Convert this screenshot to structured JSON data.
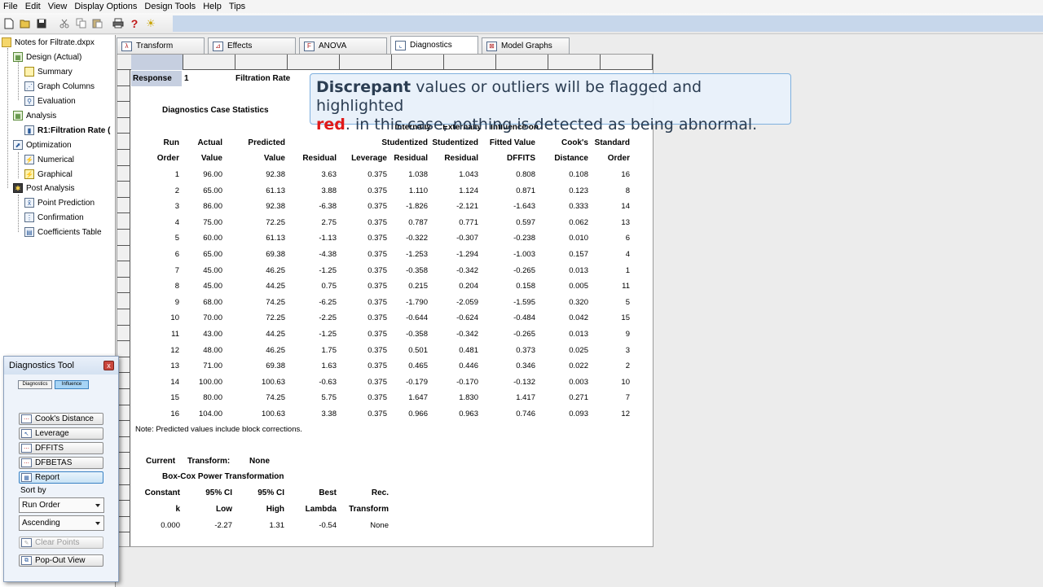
{
  "menu": [
    "File",
    "Edit",
    "View",
    "Display Options",
    "Design Tools",
    "Help",
    "Tips"
  ],
  "toolbar": {
    "icons": [
      "new-file-icon",
      "open-folder-icon",
      "save-icon",
      "cut-icon",
      "copy-icon",
      "paste-icon",
      "print-icon",
      "help-question-icon",
      "tip-lightbulb-icon"
    ],
    "help_glyph": "?",
    "tip_glyph": "☀"
  },
  "tree": {
    "root": "Notes for Filtrate.dxpx",
    "design": "Design (Actual)",
    "summary": "Summary",
    "graph_columns": "Graph Columns",
    "evaluation": "Evaluation",
    "analysis": "Analysis",
    "r1": "R1:Filtration Rate (",
    "optimization": "Optimization",
    "numerical": "Numerical",
    "graphical": "Graphical",
    "post_analysis": "Post Analysis",
    "point_prediction": "Point Prediction",
    "confirmation": "Confirmation",
    "coefficients_table": "Coefficients Table"
  },
  "tabs": [
    {
      "label": "Transform",
      "active": false
    },
    {
      "label": "Effects",
      "active": false
    },
    {
      "label": "ANOVA",
      "active": false
    },
    {
      "label": "Diagnostics",
      "active": true
    },
    {
      "label": "Model Graphs",
      "active": false
    }
  ],
  "sheet": {
    "response_label": "Response",
    "response_number": "1",
    "response_name": "Filtration Rate",
    "section_title": "Diagnostics Case Statistics",
    "headers": {
      "row1": [
        "Internally",
        "Externally",
        "Influence on"
      ],
      "row2": [
        "Run",
        "Actual",
        "Predicted",
        "Studentized",
        "Studentized",
        "Fitted Value",
        "Cook's",
        "Standard"
      ],
      "row3": [
        "Order",
        "Value",
        "Value",
        "Residual",
        "Leverage",
        "Residual",
        "Residual",
        "DFFITS",
        "Distance",
        "Order"
      ]
    },
    "rows": [
      [
        "1",
        "96.00",
        "92.38",
        "3.63",
        "0.375",
        "1.038",
        "1.043",
        "0.808",
        "0.108",
        "16"
      ],
      [
        "2",
        "65.00",
        "61.13",
        "3.88",
        "0.375",
        "1.110",
        "1.124",
        "0.871",
        "0.123",
        "8"
      ],
      [
        "3",
        "86.00",
        "92.38",
        "-6.38",
        "0.375",
        "-1.826",
        "-2.121",
        "-1.643",
        "0.333",
        "14"
      ],
      [
        "4",
        "75.00",
        "72.25",
        "2.75",
        "0.375",
        "0.787",
        "0.771",
        "0.597",
        "0.062",
        "13"
      ],
      [
        "5",
        "60.00",
        "61.13",
        "-1.13",
        "0.375",
        "-0.322",
        "-0.307",
        "-0.238",
        "0.010",
        "6"
      ],
      [
        "6",
        "65.00",
        "69.38",
        "-4.38",
        "0.375",
        "-1.253",
        "-1.294",
        "-1.003",
        "0.157",
        "4"
      ],
      [
        "7",
        "45.00",
        "46.25",
        "-1.25",
        "0.375",
        "-0.358",
        "-0.342",
        "-0.265",
        "0.013",
        "1"
      ],
      [
        "8",
        "45.00",
        "44.25",
        "0.75",
        "0.375",
        "0.215",
        "0.204",
        "0.158",
        "0.005",
        "11"
      ],
      [
        "9",
        "68.00",
        "74.25",
        "-6.25",
        "0.375",
        "-1.790",
        "-2.059",
        "-1.595",
        "0.320",
        "5"
      ],
      [
        "10",
        "70.00",
        "72.25",
        "-2.25",
        "0.375",
        "-0.644",
        "-0.624",
        "-0.484",
        "0.042",
        "15"
      ],
      [
        "11",
        "43.00",
        "44.25",
        "-1.25",
        "0.375",
        "-0.358",
        "-0.342",
        "-0.265",
        "0.013",
        "9"
      ],
      [
        "12",
        "48.00",
        "46.25",
        "1.75",
        "0.375",
        "0.501",
        "0.481",
        "0.373",
        "0.025",
        "3"
      ],
      [
        "13",
        "71.00",
        "69.38",
        "1.63",
        "0.375",
        "0.465",
        "0.446",
        "0.346",
        "0.022",
        "2"
      ],
      [
        "14",
        "100.00",
        "100.63",
        "-0.63",
        "0.375",
        "-0.179",
        "-0.170",
        "-0.132",
        "0.003",
        "10"
      ],
      [
        "15",
        "80.00",
        "74.25",
        "5.75",
        "0.375",
        "1.647",
        "1.830",
        "1.417",
        "0.271",
        "7"
      ],
      [
        "16",
        "104.00",
        "100.63",
        "3.38",
        "0.375",
        "0.966",
        "0.963",
        "0.746",
        "0.093",
        "12"
      ]
    ],
    "note": "Note: Predicted values include block corrections.",
    "transform": {
      "current": "Current",
      "transform": "Transform:",
      "value": "None"
    },
    "boxcox_title": "Box-Cox Power Transformation",
    "boxcox_headers1": [
      "Constant",
      "95% CI",
      "95% CI",
      "Best",
      "Rec."
    ],
    "boxcox_headers2": [
      "k",
      "Low",
      "High",
      "Lambda",
      "Transform"
    ],
    "boxcox_values": [
      "0.000",
      "-2.27",
      "1.31",
      "-0.54",
      "None"
    ]
  },
  "callout": {
    "bold_word": "Discrepant",
    "line1_rest": " values or outliers will be flagged and highlighted",
    "red_word": "red",
    "line2_rest": ".  in this case, nothing is detected as being abnormal."
  },
  "diag_tool": {
    "title": "Diagnostics Tool",
    "close": "x",
    "mini_tabs": [
      "Diagnostics",
      "Influence"
    ],
    "buttons": [
      "Cook's Distance",
      "Leverage",
      "DFFITS",
      "DFBETAS",
      "Report"
    ],
    "sort_by": "Sort by",
    "sort_field": "Run Order",
    "sort_dir": "Ascending",
    "clear_points": "Clear Points",
    "popout": "Pop-Out View"
  }
}
